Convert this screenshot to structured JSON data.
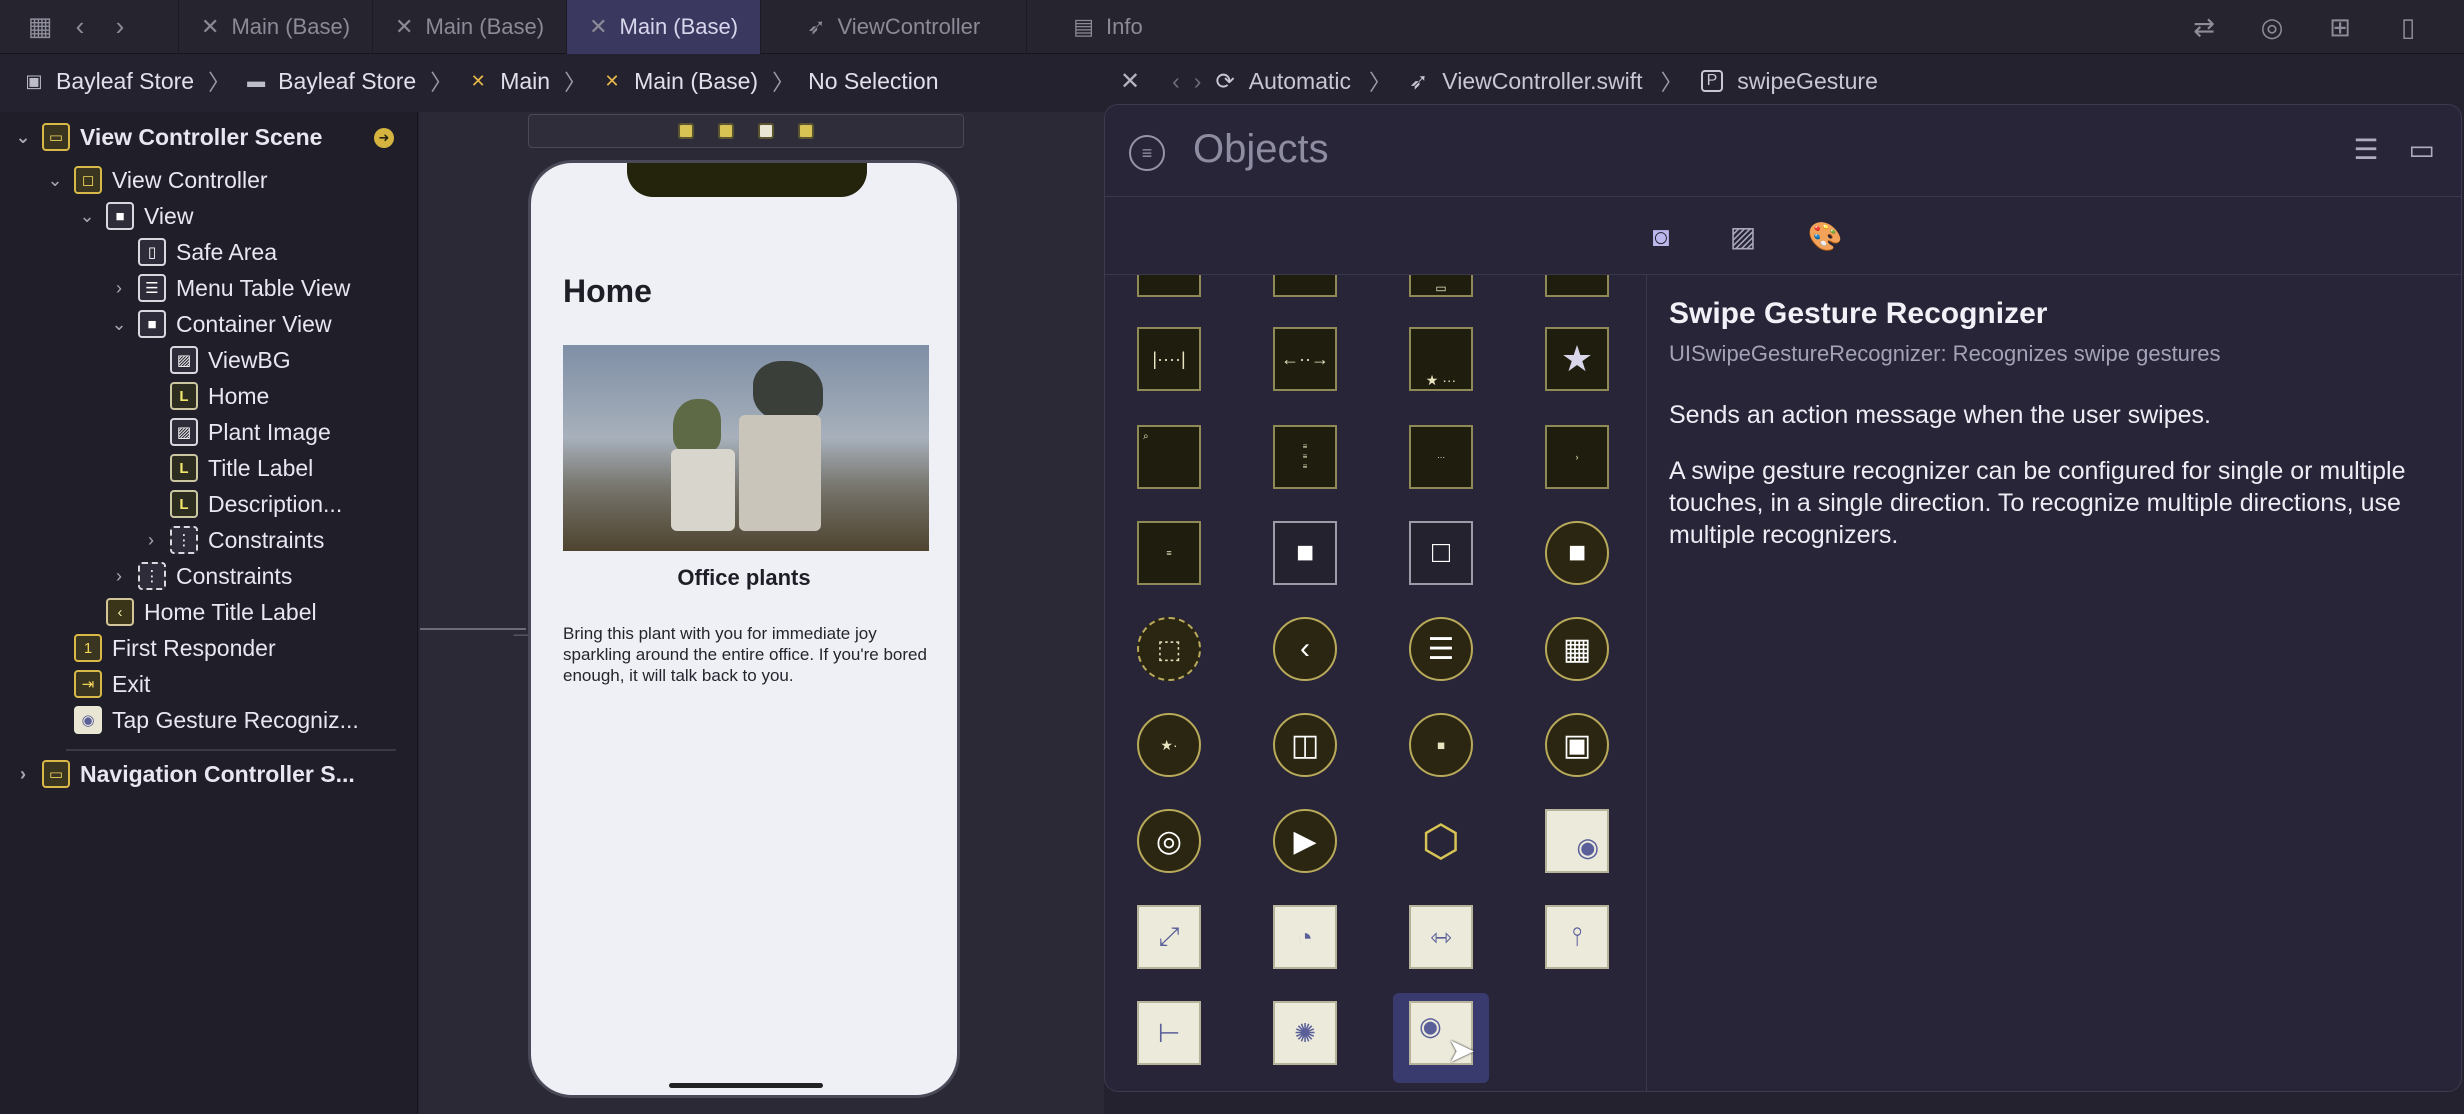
{
  "tabs": [
    {
      "label": "Main (Base)",
      "active": false
    },
    {
      "label": "Main (Base)",
      "active": false
    },
    {
      "label": "Main (Base)",
      "active": true
    },
    {
      "label": "ViewController",
      "active": false
    },
    {
      "label": "Info",
      "active": false
    }
  ],
  "breadcrumb": [
    "Bayleaf Store",
    "Bayleaf Store",
    "Main",
    "Main (Base)",
    "No Selection"
  ],
  "assistant_breadcrumb": [
    "Automatic",
    "ViewController.swift",
    "swipeGesture"
  ],
  "navigator": {
    "scene1": "View Controller Scene",
    "items": [
      {
        "label": "View Controller"
      },
      {
        "label": "View"
      },
      {
        "label": "Safe Area"
      },
      {
        "label": "Menu Table View"
      },
      {
        "label": "Container View"
      },
      {
        "label": "ViewBG"
      },
      {
        "label": "Home"
      },
      {
        "label": "Plant Image"
      },
      {
        "label": "Title Label"
      },
      {
        "label": "Description..."
      },
      {
        "label": "Constraints"
      },
      {
        "label": "Constraints"
      },
      {
        "label": "Home Title Label"
      },
      {
        "label": "First Responder"
      },
      {
        "label": "Exit"
      },
      {
        "label": "Tap Gesture Recogniz..."
      }
    ],
    "scene2": "Navigation Controller S..."
  },
  "phone": {
    "title": "Home",
    "subtitle": "Office plants",
    "description": "Bring this plant with you for immediate joy sparkling around the entire office. If you're bored enough, it will talk back to you."
  },
  "library": {
    "search_placeholder": "Objects",
    "detail_title": "Swipe Gesture Recognizer",
    "detail_class": "UISwipeGestureRecognizer: Recognizes swipe gestures",
    "detail_short": "Sends an action message when the user swipes.",
    "detail_long": "A swipe gesture recognizer can be configured for single or multiple touches, in a single direction. To recognize multiple directions, use multiple recognizers."
  },
  "colors": {
    "accent": "#3b3860",
    "tile_yellow": "#b9a95a",
    "selection": "#393a6e"
  },
  "icons": [
    "grid-icon",
    "back-icon",
    "forward-icon",
    "storyboard-icon",
    "swift-file-icon",
    "info-table-icon",
    "filter-icon",
    "list-icon",
    "panel-icon",
    "object-icon",
    "image-icon",
    "palette-icon",
    "cursor-icon"
  ]
}
